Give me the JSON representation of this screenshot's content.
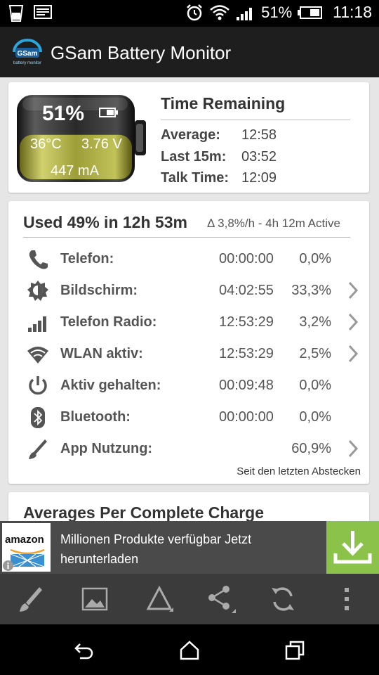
{
  "status_bar": {
    "battery_pct": "51%",
    "time": "11:18"
  },
  "app_bar": {
    "title": "GSam Battery Monitor",
    "logo_text": "GSam",
    "logo_subtext": "battery monitor"
  },
  "battery": {
    "percent": "51%",
    "temperature": "36°C",
    "voltage": "3.76 V",
    "current": "447 mA",
    "level": 0.51
  },
  "time_remaining": {
    "title": "Time Remaining",
    "rows": [
      {
        "label": "Average:",
        "value": "12:58"
      },
      {
        "label": "Last 15m:",
        "value": "03:52"
      },
      {
        "label": "Talk Time:",
        "value": "12:09"
      }
    ]
  },
  "usage": {
    "title": "Used 49% in 12h 53m",
    "subtitle": "Δ 3,8%/h - 4h 12m Active",
    "rows": [
      {
        "icon": "phone-icon",
        "name": "Telefon:",
        "time": "00:00:00",
        "pct": "0,0%",
        "chevron": false
      },
      {
        "icon": "screen-brightness-icon",
        "name": "Bildschirm:",
        "time": "04:02:55",
        "pct": "33,3%",
        "chevron": true
      },
      {
        "icon": "signal-bars-icon",
        "name": "Telefon Radio:",
        "time": "12:53:29",
        "pct": "3,2%",
        "chevron": true
      },
      {
        "icon": "wifi-icon",
        "name": "WLAN aktiv:",
        "time": "12:53:29",
        "pct": "2,5%",
        "chevron": true
      },
      {
        "icon": "power-icon",
        "name": "Aktiv gehalten:",
        "time": "00:09:48",
        "pct": "0,0%",
        "chevron": false
      },
      {
        "icon": "bluetooth-icon",
        "name": "Bluetooth:",
        "time": "00:00:00",
        "pct": "0,0%",
        "chevron": false
      },
      {
        "icon": "app-usage-icon",
        "name": "App Nutzung:",
        "time": "",
        "pct": "60,9%",
        "chevron": true
      }
    ],
    "footer": "Seit den letzten Abstecken"
  },
  "averages": {
    "title": "Averages Per Complete Charge"
  },
  "ad": {
    "brand": "amazon",
    "line1": "Millionen Produkte verfügbar Jetzt",
    "line2": "herunterladen"
  },
  "colors": {
    "accent_green": "#8bc34a",
    "battery_fill": "#c8c85a",
    "app_bar": "#1e1e1e",
    "toolbar": "#3b3b3b"
  }
}
